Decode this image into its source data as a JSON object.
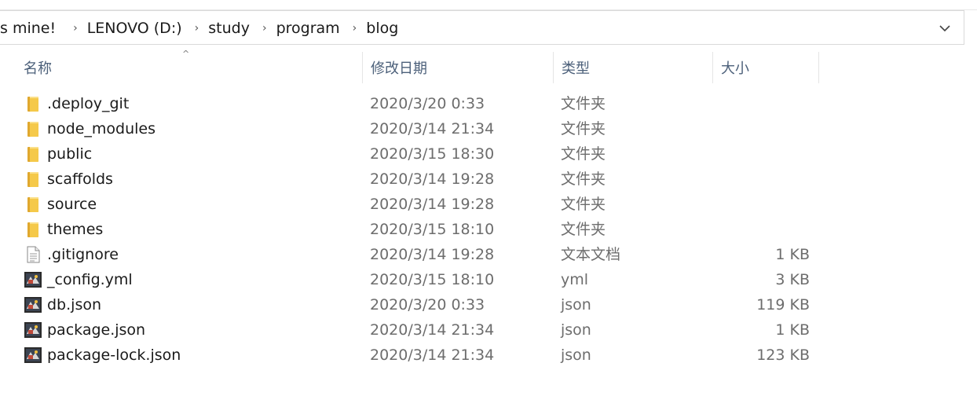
{
  "address": {
    "crumbs": [
      "s mine!",
      "LENOVO (D:)",
      "study",
      "program",
      "blog"
    ],
    "separator": "›",
    "dropdown": "⌄"
  },
  "columns": {
    "name": "名称",
    "date": "修改日期",
    "type": "类型",
    "size": "大小",
    "sort_caret": "^"
  },
  "files": [
    {
      "name": ".deploy_git",
      "date": "2020/3/20 0:33",
      "type": "文件夹",
      "size": "",
      "icon": "folder-icon"
    },
    {
      "name": "node_modules",
      "date": "2020/3/14 21:34",
      "type": "文件夹",
      "size": "",
      "icon": "folder-icon"
    },
    {
      "name": "public",
      "date": "2020/3/15 18:30",
      "type": "文件夹",
      "size": "",
      "icon": "folder-icon"
    },
    {
      "name": "scaffolds",
      "date": "2020/3/14 19:28",
      "type": "文件夹",
      "size": "",
      "icon": "folder-icon"
    },
    {
      "name": "source",
      "date": "2020/3/14 19:28",
      "type": "文件夹",
      "size": "",
      "icon": "folder-icon"
    },
    {
      "name": "themes",
      "date": "2020/3/15 18:10",
      "type": "文件夹",
      "size": "",
      "icon": "folder-icon"
    },
    {
      "name": ".gitignore",
      "date": "2020/3/14 19:28",
      "type": "文本文档",
      "size": "1 KB",
      "icon": "text-file-icon"
    },
    {
      "name": "_config.yml",
      "date": "2020/3/15 18:10",
      "type": "yml",
      "size": "3 KB",
      "icon": "app-file-icon"
    },
    {
      "name": "db.json",
      "date": "2020/3/20 0:33",
      "type": "json",
      "size": "119 KB",
      "icon": "app-file-icon"
    },
    {
      "name": "package.json",
      "date": "2020/3/14 21:34",
      "type": "json",
      "size": "1 KB",
      "icon": "app-file-icon"
    },
    {
      "name": "package-lock.json",
      "date": "2020/3/14 21:34",
      "type": "json",
      "size": "123 KB",
      "icon": "app-file-icon"
    }
  ],
  "colors": {
    "folder": "#f5c94a",
    "folder_dark": "#e0a82e",
    "header_text": "#4c607a",
    "secondary_text": "#6d6d6d"
  }
}
